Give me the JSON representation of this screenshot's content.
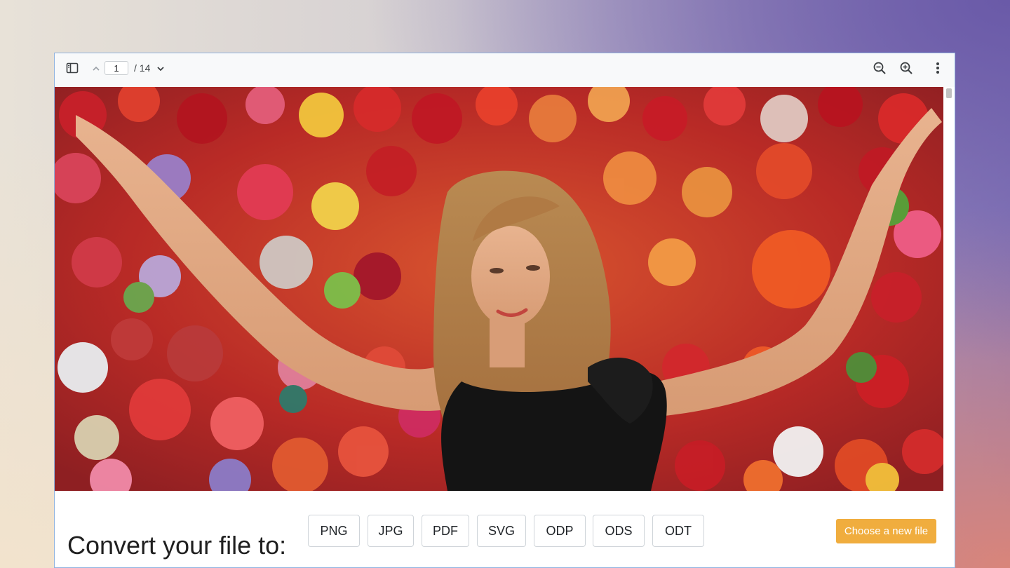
{
  "toolbar": {
    "current_page": "1",
    "total_pages": "/ 14",
    "sidebar_toggle_icon": "sidebar-icon",
    "prev_page_icon": "chevron-up-icon",
    "next_page_icon": "chevron-down-icon",
    "zoom_out_icon": "zoom-out-icon",
    "zoom_in_icon": "zoom-in-icon",
    "more_icon": "more-vertical-icon"
  },
  "document": {
    "image_icon": "photo-woman-flower-wall"
  },
  "convert": {
    "label": "Convert your file to:",
    "formats": [
      "PNG",
      "JPG",
      "PDF",
      "SVG",
      "ODP",
      "ODS",
      "ODT"
    ],
    "choose_label": "Choose a new file",
    "choose_color": "#f0ad3e"
  }
}
